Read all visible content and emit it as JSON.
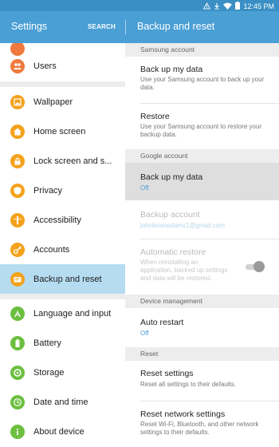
{
  "status_bar": {
    "time": "12:45 PM"
  },
  "header": {
    "title": "Settings",
    "search_label": "SEARCH",
    "right_title": "Backup and reset"
  },
  "sidebar": {
    "items": [
      {
        "label": "Users",
        "icon": "users-icon",
        "color": "#f07a3e"
      },
      {
        "label": "Wallpaper",
        "icon": "wallpaper-icon",
        "color": "#f4a21c"
      },
      {
        "label": "Home screen",
        "icon": "home-icon",
        "color": "#f4a21c"
      },
      {
        "label": "Lock screen and s...",
        "icon": "lock-icon",
        "color": "#f4a21c"
      },
      {
        "label": "Privacy",
        "icon": "privacy-icon",
        "color": "#f4a21c"
      },
      {
        "label": "Accessibility",
        "icon": "accessibility-icon",
        "color": "#f4a21c"
      },
      {
        "label": "Accounts",
        "icon": "key-icon",
        "color": "#f4a21c"
      },
      {
        "label": "Backup and reset",
        "icon": "backup-icon",
        "color": "#f4a21c"
      },
      {
        "label": "Language and input",
        "icon": "language-icon",
        "color": "#6cbf3f"
      },
      {
        "label": "Battery",
        "icon": "battery-icon",
        "color": "#6cbf3f"
      },
      {
        "label": "Storage",
        "icon": "storage-icon",
        "color": "#6cbf3f"
      },
      {
        "label": "Date and time",
        "icon": "clock-icon",
        "color": "#6cbf3f"
      },
      {
        "label": "About device",
        "icon": "info-icon",
        "color": "#6cbf3f"
      }
    ],
    "active": "Backup and reset"
  },
  "content": {
    "samsung_header": "Samsung account",
    "samsung_backup": {
      "title": "Back up my data",
      "summary": "Use your Samsung account to back up your data."
    },
    "samsung_restore": {
      "title": "Restore",
      "summary": "Use your Samsung account to restore your backup data."
    },
    "google_header": "Google account",
    "google_backup": {
      "title": "Back up my data",
      "value": "Off"
    },
    "backup_account": {
      "title": "Backup account",
      "value": "johnbrianadams1@gmail.com"
    },
    "auto_restore": {
      "title": "Automatic restore",
      "summary": "When reinstalling an application, backed up settings and data will be restored."
    },
    "device_header": "Device management",
    "auto_restart": {
      "title": "Auto restart",
      "value": "Off"
    },
    "reset_header": "Reset",
    "reset_settings": {
      "title": "Reset settings",
      "summary": "Reset all settings to their defaults."
    },
    "reset_network": {
      "title": "Reset network settings",
      "summary": "Reset Wi-Fi, Bluetooth, and other network settings to their defaults."
    }
  },
  "colors": {
    "header": "#4a9fd4",
    "status_bar": "#3a8fc4",
    "active_row": "#b5dcf0",
    "accent": "#4a9fd4"
  }
}
